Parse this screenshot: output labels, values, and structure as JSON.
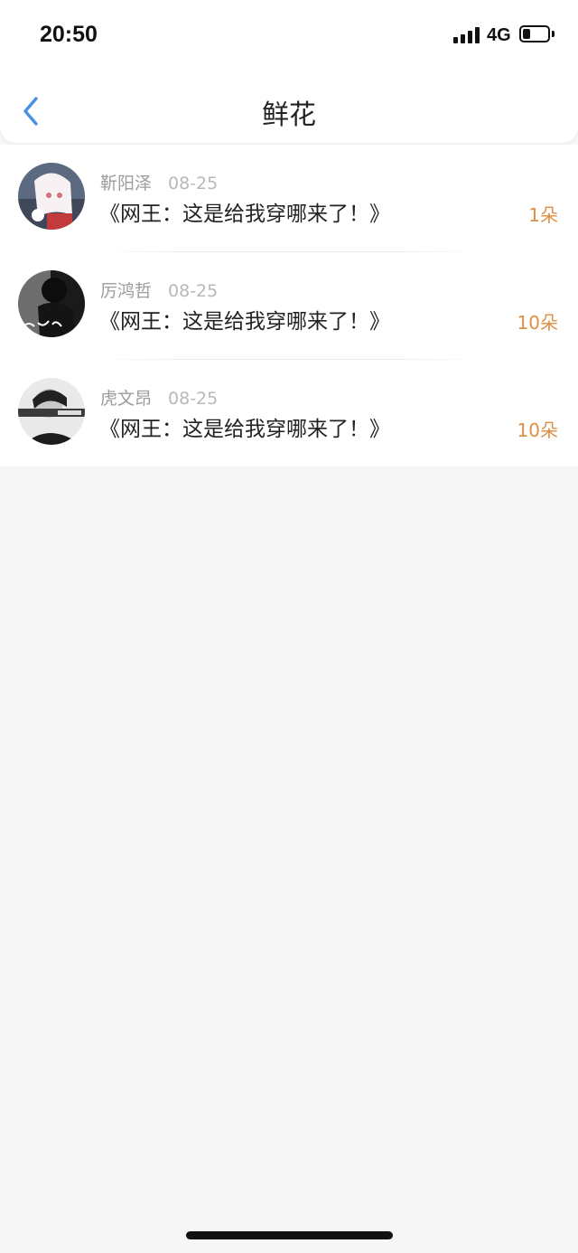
{
  "status_bar": {
    "time": "20:50",
    "network": "4G",
    "battery_level": 0.3
  },
  "nav": {
    "title": "鲜花",
    "back_icon": "chevron-left-icon",
    "accent_color": "#4a90e2"
  },
  "items": [
    {
      "name": "靳阳泽",
      "date": "08-25",
      "message": "《网王：这是给我穿哪来了！》",
      "count": "1朵"
    },
    {
      "name": "厉鸿哲",
      "date": "08-25",
      "message": "《网王：这是给我穿哪来了！》",
      "count": "10朵"
    },
    {
      "name": "虎文昂",
      "date": "08-25",
      "message": "《网王：这是给我穿哪来了！》",
      "count": "10朵"
    }
  ],
  "count_color": "#e08e43"
}
